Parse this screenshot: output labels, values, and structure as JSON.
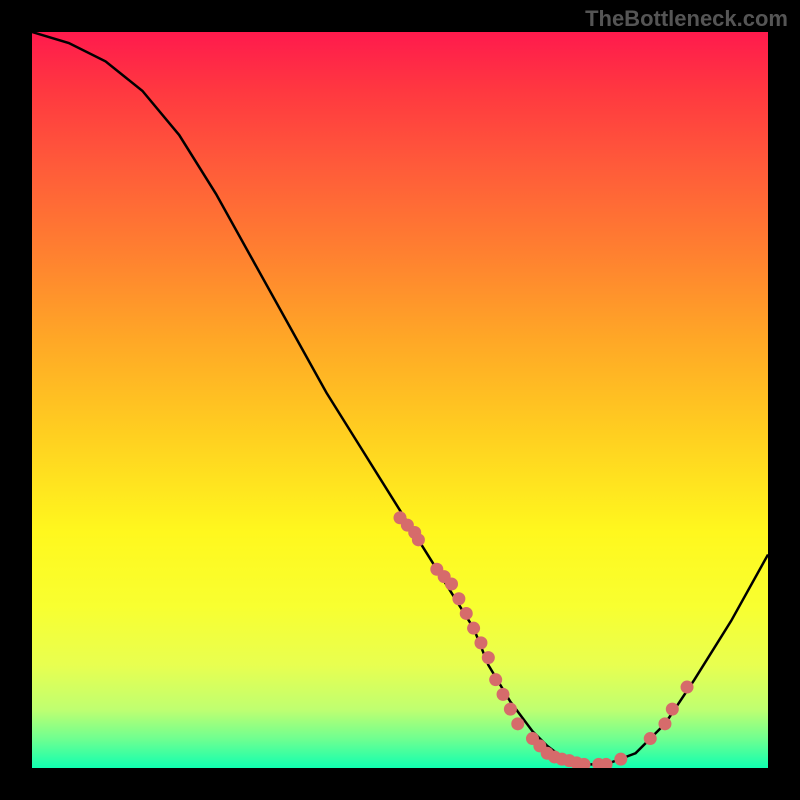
{
  "watermark": "TheBottleneck.com",
  "chart_data": {
    "type": "line",
    "title": "",
    "xlabel": "",
    "ylabel": "",
    "xlim": [
      0,
      100
    ],
    "ylim": [
      0,
      100
    ],
    "curve": {
      "x": [
        0,
        5,
        10,
        15,
        20,
        25,
        30,
        35,
        40,
        45,
        50,
        55,
        60,
        62,
        65,
        68,
        70,
        72,
        75,
        78,
        82,
        86,
        90,
        95,
        100
      ],
      "y": [
        100,
        98.5,
        96,
        92,
        86,
        78,
        69,
        60,
        51,
        43,
        35,
        27,
        19,
        14,
        9,
        5,
        3,
        1.5,
        0.5,
        0.5,
        2,
        6,
        12,
        20,
        29
      ]
    },
    "points": [
      {
        "x": 50,
        "y": 34
      },
      {
        "x": 51,
        "y": 33
      },
      {
        "x": 52,
        "y": 32
      },
      {
        "x": 52.5,
        "y": 31
      },
      {
        "x": 55,
        "y": 27
      },
      {
        "x": 56,
        "y": 26
      },
      {
        "x": 57,
        "y": 25
      },
      {
        "x": 58,
        "y": 23
      },
      {
        "x": 59,
        "y": 21
      },
      {
        "x": 60,
        "y": 19
      },
      {
        "x": 61,
        "y": 17
      },
      {
        "x": 62,
        "y": 15
      },
      {
        "x": 63,
        "y": 12
      },
      {
        "x": 64,
        "y": 10
      },
      {
        "x": 65,
        "y": 8
      },
      {
        "x": 66,
        "y": 6
      },
      {
        "x": 68,
        "y": 4
      },
      {
        "x": 69,
        "y": 3
      },
      {
        "x": 70,
        "y": 2
      },
      {
        "x": 71,
        "y": 1.5
      },
      {
        "x": 72,
        "y": 1.2
      },
      {
        "x": 73,
        "y": 1
      },
      {
        "x": 74,
        "y": 0.7
      },
      {
        "x": 75,
        "y": 0.5
      },
      {
        "x": 77,
        "y": 0.5
      },
      {
        "x": 78,
        "y": 0.5
      },
      {
        "x": 80,
        "y": 1.2
      },
      {
        "x": 84,
        "y": 4
      },
      {
        "x": 86,
        "y": 6
      },
      {
        "x": 87,
        "y": 8
      },
      {
        "x": 89,
        "y": 11
      }
    ],
    "colors": {
      "curve": "#000000",
      "points": "#d66b6b"
    }
  }
}
